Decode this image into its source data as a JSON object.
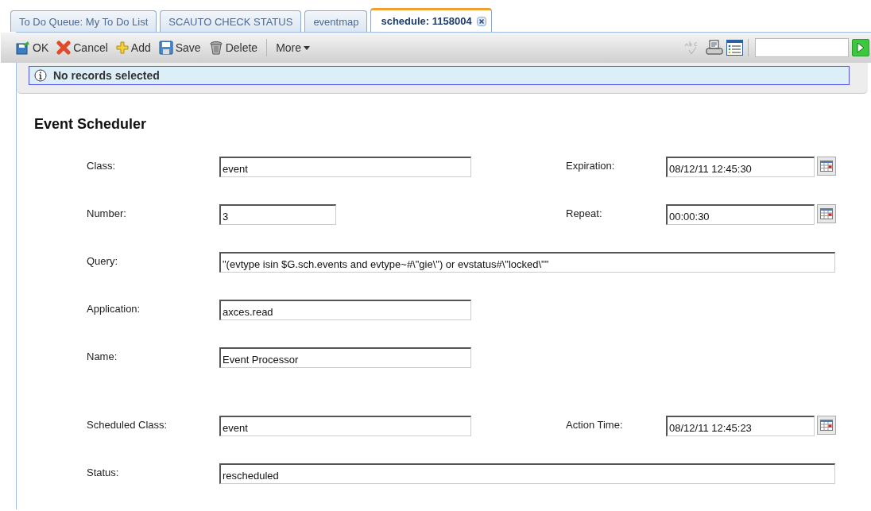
{
  "tabs": [
    {
      "label": "To Do Queue: My To Do List",
      "selected": false,
      "closable": false
    },
    {
      "label": "SCAUTO CHECK STATUS",
      "selected": false,
      "closable": false
    },
    {
      "label": "eventmap",
      "selected": false,
      "closable": false
    },
    {
      "label": "schedule: 1158004",
      "selected": true,
      "closable": true
    }
  ],
  "toolbar": {
    "buttons": [
      {
        "kind": "ok",
        "label": "OK"
      },
      {
        "kind": "cancel",
        "label": "Cancel"
      },
      {
        "kind": "add",
        "label": "Add"
      },
      {
        "kind": "save",
        "label": "Save"
      },
      {
        "kind": "delete",
        "label": "Delete"
      }
    ],
    "more": "More",
    "spellcheck_disabled": true
  },
  "info": "No records selected",
  "title": "Event Scheduler",
  "sections": [
    [
      {
        "fields": [
          {
            "label": "Class:",
            "value": "event",
            "kind": "medium"
          },
          {
            "label": "Expiration:",
            "value": "08/12/11 12:45:30",
            "kind": "date"
          }
        ]
      },
      {
        "fields": [
          {
            "label": "Number:",
            "value": "3",
            "kind": "short"
          },
          {
            "label": "Repeat:",
            "value": "00:00:30",
            "kind": "date"
          }
        ]
      },
      {
        "fields": [
          {
            "label": "Query:",
            "value": "\"(evtype isin $G.sch.events and evtype~#\\\"gie\\\") or evstatus#\\\"locked\\\"\"",
            "kind": "long"
          }
        ]
      },
      {
        "fields": [
          {
            "label": "Application:",
            "value": "axces.read",
            "kind": "medium"
          }
        ]
      },
      {
        "fields": [
          {
            "label": "Name:",
            "value": "Event Processor",
            "kind": "medium"
          }
        ]
      }
    ],
    [
      {
        "fields": [
          {
            "label": "Scheduled Class:",
            "value": "event",
            "kind": "medium"
          },
          {
            "label": "Action Time:",
            "value": "08/12/11 12:45:23",
            "kind": "date"
          }
        ]
      },
      {
        "fields": [
          {
            "label": "Status:",
            "value": "rescheduled",
            "kind": "long"
          }
        ]
      }
    ]
  ]
}
